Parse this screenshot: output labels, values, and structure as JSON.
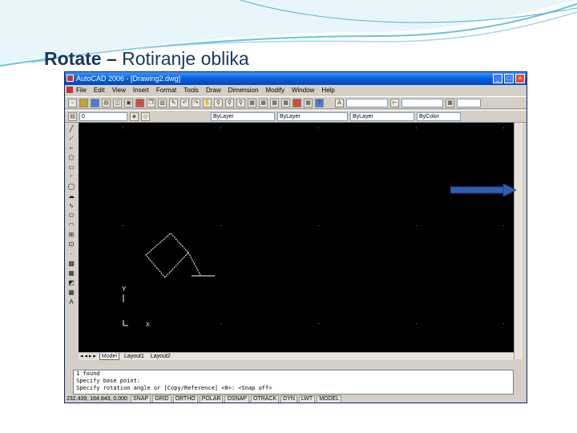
{
  "slide": {
    "title_bold": "Rotate –",
    "title_rest": " Rotiranje oblika"
  },
  "window": {
    "title": "AutoCAD 2006 - [Drawing2.dwg]",
    "buttons": [
      "_",
      "□",
      "×"
    ]
  },
  "menu": [
    "File",
    "Edit",
    "View",
    "Insert",
    "Format",
    "Tools",
    "Draw",
    "Dimension",
    "Modify",
    "Window",
    "Help"
  ],
  "toolbar2": {
    "layer_value": "0",
    "color_value": "ByLayer",
    "linetype_value": "ByLayer",
    "lineweight_value": "ByLayer",
    "plotstyle_value": "ByColor"
  },
  "layout_tabs": [
    "Model",
    "Layout1",
    "Layout2"
  ],
  "command_lines": [
    "1 found",
    "Specify base point:",
    "Specify rotation angle or [Copy/Reference] <0>:   <Snap off>"
  ],
  "status": {
    "coordinates": "232.439, 164.843, 0.000",
    "buttons": [
      "SNAP",
      "GRID",
      "ORTHO",
      "POLAR",
      "OSNAP",
      "OTRACK",
      "DYN",
      "LWT",
      "MODEL"
    ]
  },
  "colors": {
    "title_color": "#17375e",
    "canvas_bg": "#000000",
    "titlebar_blue": "#0a5fd8",
    "arrow_blue": "#2e5fb5"
  }
}
